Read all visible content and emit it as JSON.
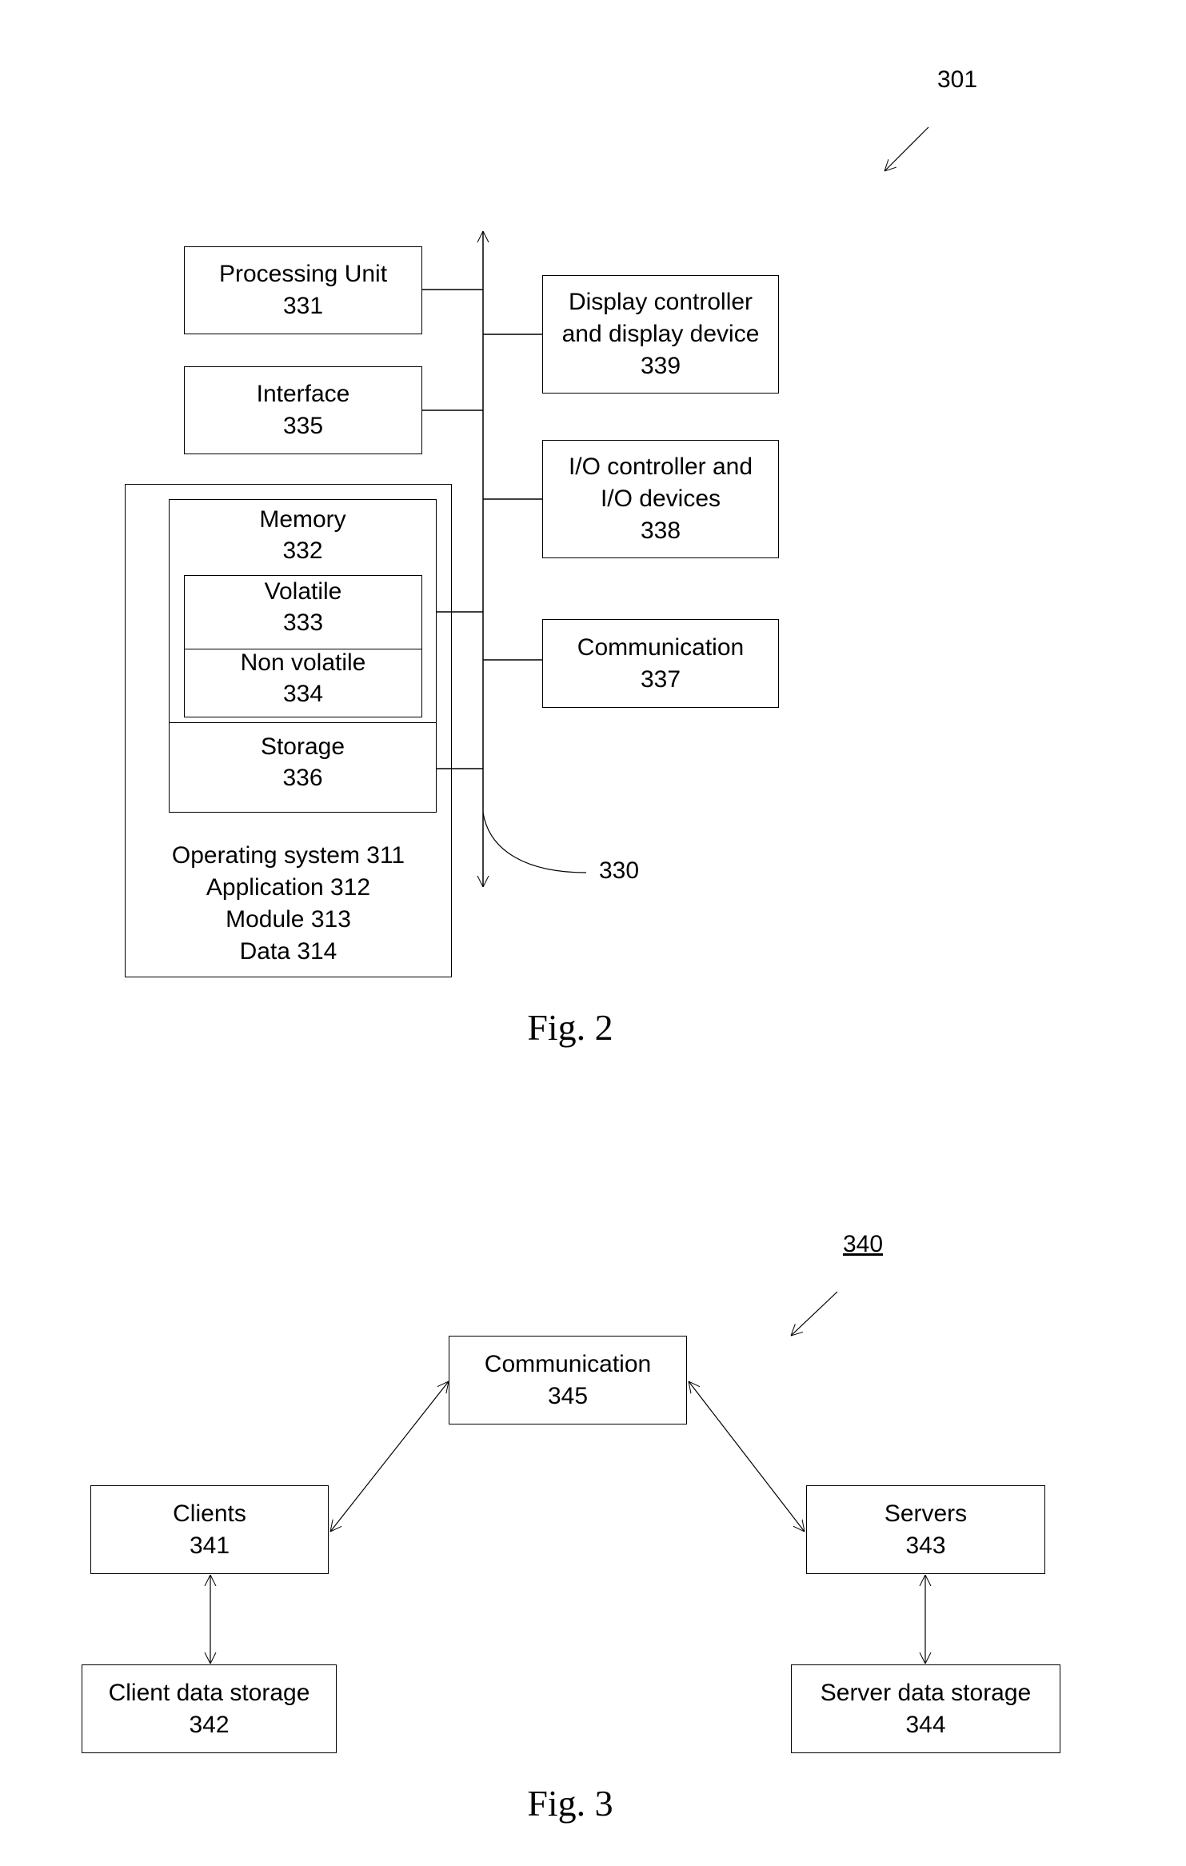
{
  "fig2": {
    "ref_label": "301",
    "bus_label": "330",
    "caption": "Fig. 2",
    "processing_unit": {
      "name": "Processing Unit",
      "num": "331"
    },
    "interface": {
      "name": "Interface",
      "num": "335"
    },
    "memory": {
      "name": "Memory",
      "num": "332"
    },
    "volatile": {
      "name": "Volatile",
      "num": "333"
    },
    "non_volatile": {
      "name": "Non volatile",
      "num": "334"
    },
    "storage": {
      "name": "Storage",
      "num": "336"
    },
    "display": {
      "line1": "Display controller",
      "line2": "and display device",
      "num": "339"
    },
    "io": {
      "line1": "I/O controller and",
      "line2": "I/O devices",
      "num": "338"
    },
    "communication": {
      "name": "Communication",
      "num": "337"
    },
    "software": [
      "Operating system 311",
      "Application 312",
      "Module 313",
      "Data 314"
    ]
  },
  "fig3": {
    "ref_label": "340",
    "caption": "Fig. 3",
    "communication": {
      "name": "Communication",
      "num": "345"
    },
    "clients": {
      "name": "Clients",
      "num": "341"
    },
    "servers": {
      "name": "Servers",
      "num": "343"
    },
    "client_storage": {
      "name": "Client data storage",
      "num": "342"
    },
    "server_storage": {
      "name": "Server data storage",
      "num": "344"
    }
  }
}
